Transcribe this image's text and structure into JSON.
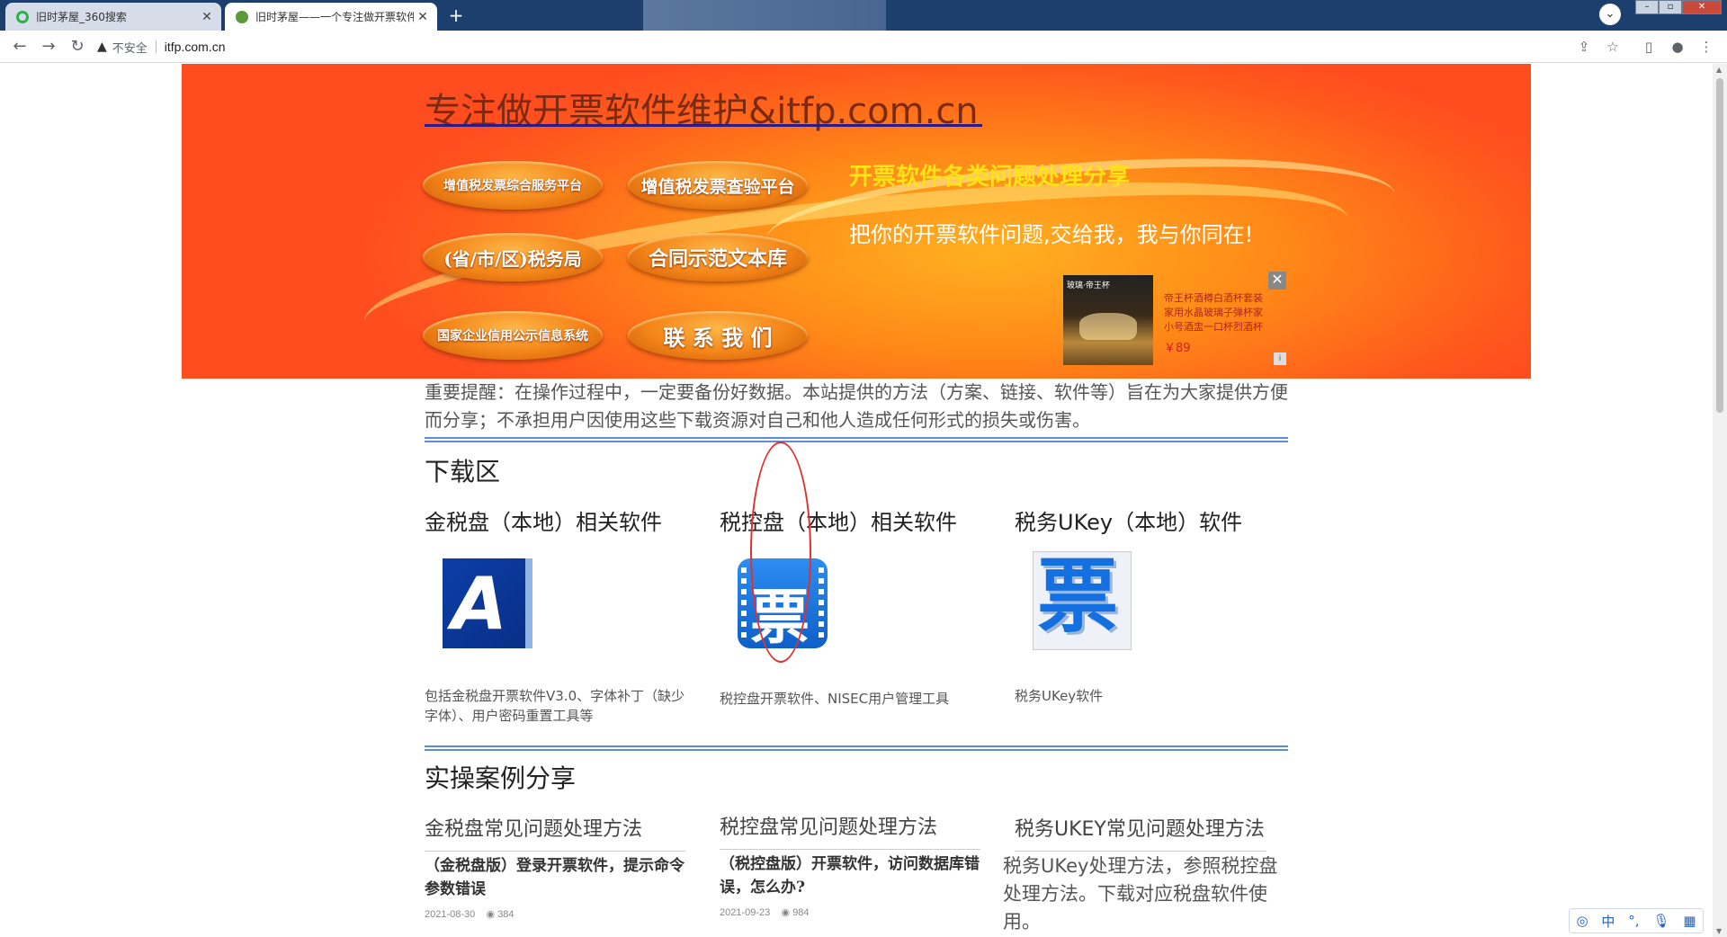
{
  "browser": {
    "tabs": [
      {
        "title": "旧时茅屋_360搜索",
        "active": false
      },
      {
        "title": "旧时茅屋——一个专注做开票软件",
        "active": true
      }
    ],
    "address": {
      "security_label": "不安全",
      "url": "itfp.com.cn"
    }
  },
  "banner": {
    "site_title": "专注做开票软件维护&itfp.com.cn",
    "buttons": [
      {
        "label": "增值税发票综合服务平台"
      },
      {
        "label": "增值税发票查验平台"
      },
      {
        "label": "(省/市/区)税务局"
      },
      {
        "label": "合同示范文本库"
      },
      {
        "label": "国家企业信用公示信息系统"
      },
      {
        "label": "联 系 我 们"
      }
    ],
    "slogan_main": "开票软件各类问题处理分享",
    "slogan_sub": "把你的开票软件问题,交给我，我与你同在!",
    "ad": {
      "image_tag": "玻璃·帝王杯",
      "text": "帝王杯酒樽白酒杯套装家用水晶玻璃子弹杯家小号酒盅一口杯烈酒杯",
      "price": "￥89"
    }
  },
  "notice": "重要提醒：在操作过程中，一定要备份好数据。本站提供的方法（方案、链接、软件等）旨在为大家提供方便而分享；不承担用户因使用这些下载资源对自己和他人造成任何形式的损失或伤害。",
  "downloads": {
    "heading": "下载区",
    "columns": [
      {
        "title": "金税盘（本地）相关软件",
        "icon_text": "A",
        "desc": "包括金税盘开票软件V3.0、字体补丁（缺少字体）、用户密码重置工具等"
      },
      {
        "title": "税控盘（本地）相关软件",
        "icon_text": "票",
        "desc": "税控盘开票软件、NISEC用户管理工具"
      },
      {
        "title": "税务UKey（本地）软件",
        "icon_text": "票",
        "desc": "税务UKey软件"
      }
    ]
  },
  "cases": {
    "heading": "实操案例分享",
    "columns": [
      {
        "title": "金税盘常见问题处理方法",
        "item": "（金税盘版）登录开票软件，提示命令参数错误",
        "date": "2021-08-30",
        "views": "384"
      },
      {
        "title": "税控盘常见问题处理方法",
        "item": "（税控盘版）开票软件，访问数据库错误，怎么办?",
        "date": "2021-09-23",
        "views": "984"
      },
      {
        "title": "税务UKEY常见问题处理方法",
        "text": "税务UKey处理方法，参照税控盘处理方法。下载对应税盘软件使用。"
      }
    ]
  },
  "ime": {
    "lang": "中"
  }
}
